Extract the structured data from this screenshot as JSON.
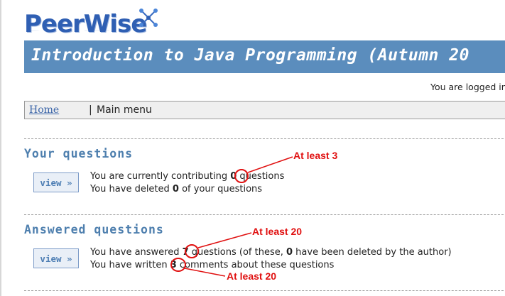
{
  "brand": {
    "name": "PeerWise"
  },
  "course": {
    "title": "Introduction to Java Programming (Autumn 20"
  },
  "header": {
    "logged_in_text": "You are logged in"
  },
  "breadcrumb": {
    "home": "Home",
    "separator": "|",
    "current": "Main menu"
  },
  "your_questions": {
    "title": "Your questions",
    "view_label": "view »",
    "line1": {
      "prefix": "You are currently contributing ",
      "count": "0",
      "suffix": " questions"
    },
    "line2": {
      "prefix": "You have deleted ",
      "count": "0",
      "suffix": " of your questions"
    }
  },
  "answered_questions": {
    "title": "Answered questions",
    "view_label": "view »",
    "line1": {
      "prefix": "You have answered ",
      "count": "7",
      "middle": " questions (of these, ",
      "deleted": "0",
      "suffix": " have been deleted by the author)"
    },
    "line2": {
      "prefix": "You have written ",
      "count": "3",
      "suffix": " comments about these questions"
    }
  },
  "annotations": {
    "contrib": "At least 3",
    "answered": "At least 20",
    "comments": "At least 20",
    "color": "#e01010"
  },
  "colors": {
    "banner": "#5b8dbd",
    "section_title": "#4e7fae",
    "link": "#3a64a8"
  }
}
